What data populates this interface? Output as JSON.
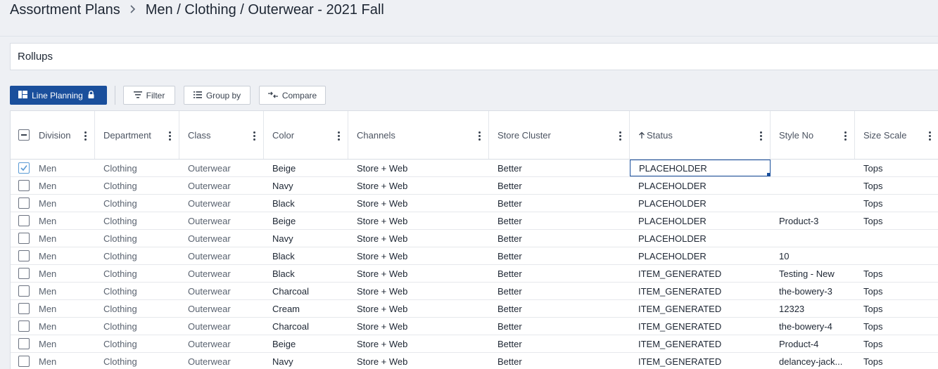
{
  "breadcrumb": {
    "root": "Assortment Plans",
    "current": "Men / Clothing / Outerwear - 2021 Fall"
  },
  "rollups": {
    "label": "Rollups"
  },
  "toolbar": {
    "line_planning": "Line Planning",
    "filter": "Filter",
    "group_by": "Group by",
    "compare": "Compare"
  },
  "colors": {
    "primary": "#1a4f9c",
    "checkbox_checked": "#5b9bd5"
  },
  "table": {
    "columns": [
      {
        "key": "division",
        "label": "Division"
      },
      {
        "key": "department",
        "label": "Department"
      },
      {
        "key": "class",
        "label": "Class"
      },
      {
        "key": "color",
        "label": "Color"
      },
      {
        "key": "channels",
        "label": "Channels"
      },
      {
        "key": "store_cluster",
        "label": "Store Cluster"
      },
      {
        "key": "status",
        "label": "Status",
        "sort": "ascending"
      },
      {
        "key": "style_no",
        "label": "Style No"
      },
      {
        "key": "size_scale",
        "label": "Size Scale"
      }
    ],
    "rows": [
      {
        "checked": true,
        "division": "Men",
        "department": "Clothing",
        "class": "Outerwear",
        "color": "Beige",
        "channels": "Store + Web",
        "store_cluster": "Better",
        "status": "PLACEHOLDER",
        "style_no": "",
        "size_scale": "Tops"
      },
      {
        "checked": false,
        "division": "Men",
        "department": "Clothing",
        "class": "Outerwear",
        "color": "Navy",
        "channels": "Store + Web",
        "store_cluster": "Better",
        "status": "PLACEHOLDER",
        "style_no": "",
        "size_scale": "Tops"
      },
      {
        "checked": false,
        "division": "Men",
        "department": "Clothing",
        "class": "Outerwear",
        "color": "Black",
        "channels": "Store + Web",
        "store_cluster": "Better",
        "status": "PLACEHOLDER",
        "style_no": "",
        "size_scale": "Tops"
      },
      {
        "checked": false,
        "division": "Men",
        "department": "Clothing",
        "class": "Outerwear",
        "color": "Beige",
        "channels": "Store + Web",
        "store_cluster": "Better",
        "status": "PLACEHOLDER",
        "style_no": "Product-3",
        "size_scale": "Tops"
      },
      {
        "checked": false,
        "division": "Men",
        "department": "Clothing",
        "class": "Outerwear",
        "color": "Navy",
        "channels": "Store + Web",
        "store_cluster": "Better",
        "status": "PLACEHOLDER",
        "style_no": "",
        "size_scale": ""
      },
      {
        "checked": false,
        "division": "Men",
        "department": "Clothing",
        "class": "Outerwear",
        "color": "Black",
        "channels": "Store + Web",
        "store_cluster": "Better",
        "status": "PLACEHOLDER",
        "style_no": "10",
        "size_scale": ""
      },
      {
        "checked": false,
        "division": "Men",
        "department": "Clothing",
        "class": "Outerwear",
        "color": "Black",
        "channels": "Store + Web",
        "store_cluster": "Better",
        "status": "ITEM_GENERATED",
        "style_no": "Testing - New",
        "size_scale": "Tops"
      },
      {
        "checked": false,
        "division": "Men",
        "department": "Clothing",
        "class": "Outerwear",
        "color": "Charcoal",
        "channels": "Store + Web",
        "store_cluster": "Better",
        "status": "ITEM_GENERATED",
        "style_no": "the-bowery-3",
        "size_scale": "Tops"
      },
      {
        "checked": false,
        "division": "Men",
        "department": "Clothing",
        "class": "Outerwear",
        "color": "Cream",
        "channels": "Store + Web",
        "store_cluster": "Better",
        "status": "ITEM_GENERATED",
        "style_no": "12323",
        "size_scale": "Tops"
      },
      {
        "checked": false,
        "division": "Men",
        "department": "Clothing",
        "class": "Outerwear",
        "color": "Charcoal",
        "channels": "Store + Web",
        "store_cluster": "Better",
        "status": "ITEM_GENERATED",
        "style_no": "the-bowery-4",
        "size_scale": "Tops"
      },
      {
        "checked": false,
        "division": "Men",
        "department": "Clothing",
        "class": "Outerwear",
        "color": "Beige",
        "channels": "Store + Web",
        "store_cluster": "Better",
        "status": "ITEM_GENERATED",
        "style_no": "Product-4",
        "size_scale": "Tops"
      },
      {
        "checked": false,
        "division": "Men",
        "department": "Clothing",
        "class": "Outerwear",
        "color": "Navy",
        "channels": "Store + Web",
        "store_cluster": "Better",
        "status": "ITEM_GENERATED",
        "style_no": "delancey-jack...",
        "size_scale": "Tops"
      }
    ]
  }
}
